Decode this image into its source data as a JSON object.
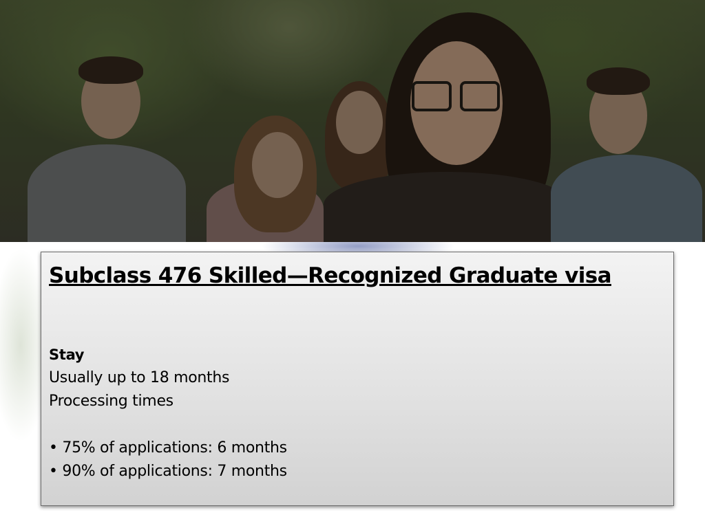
{
  "slide": {
    "title": "Subclass 476 Skilled—Recognized Graduate visa",
    "stay_label": "Stay",
    "stay_value": "Usually up to 18 months",
    "processing_label": "Processing times",
    "bullets": [
      "• 75% of applications: 6 months",
      "• 90% of applications: 7 months"
    ]
  },
  "colors": {
    "text": "#000000",
    "box_top": "#f3f3f3",
    "box_bottom": "#d2d2d2",
    "box_border": "#6b6b6b"
  }
}
